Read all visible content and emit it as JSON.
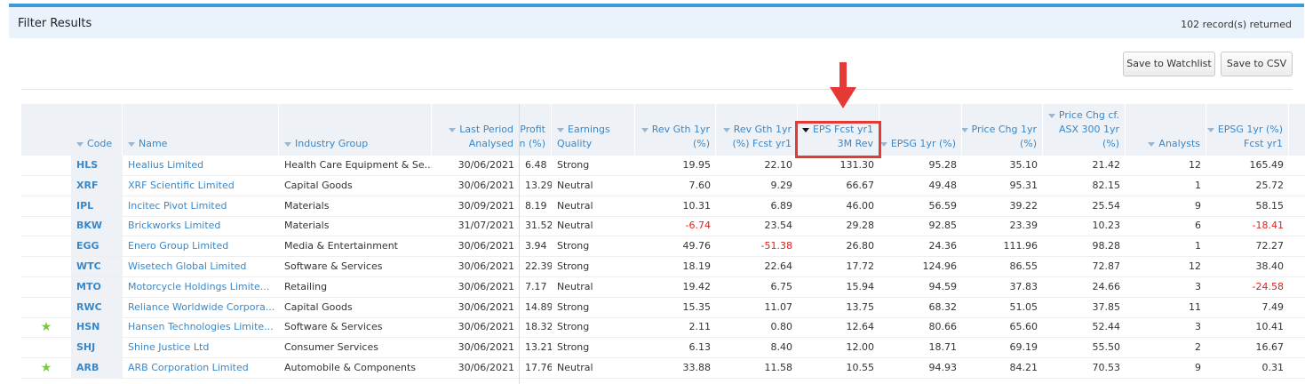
{
  "header": {
    "title": "Filter Results",
    "records": "102 record(s) returned"
  },
  "buttons": {
    "watchlist": "Save to Watchlist",
    "csv": "Save to CSV"
  },
  "columns": [
    {
      "l1": "",
      "l2": "Code"
    },
    {
      "l1": "",
      "l2": "Name"
    },
    {
      "l1": "",
      "l2": "Industry Group"
    },
    {
      "l1": "Last Period",
      "l2": "Analysed"
    },
    {
      "l1": "Profit",
      "l2": "in (%)"
    },
    {
      "l1": "Earnings",
      "l2": "Quality"
    },
    {
      "l1": "Rev Gth 1yr",
      "l2": "(%)"
    },
    {
      "l1": "Rev Gth 1yr",
      "l2": "(%) Fcst yr1"
    },
    {
      "l1": "EPS Fcst yr1",
      "l2": "3M Rev"
    },
    {
      "l1": "",
      "l2": "EPSG 1yr (%)"
    },
    {
      "l1": "Price Chg 1yr",
      "l2": "(%)"
    },
    {
      "l0": "Price Chg cf.",
      "l1": "ASX 300 1yr",
      "l2": "(%)"
    },
    {
      "l1": "",
      "l2": "Analysts"
    },
    {
      "l1": "EPSG 1yr (%)",
      "l2": "Fcst yr1"
    }
  ],
  "rows": [
    {
      "star": "",
      "code": "HLS",
      "name": "Healius Limited",
      "industry": "Health Care Equipment & Se...",
      "period": "30/06/2021",
      "margin": "6.48",
      "quality": "Strong",
      "rev1": "19.95",
      "rev1f": "22.10",
      "epsrev": "131.30",
      "epsg": "95.28",
      "price": "35.10",
      "pricecf": "21.42",
      "analysts": "12",
      "epsgf": "165.49"
    },
    {
      "star": "",
      "code": "XRF",
      "name": "XRF Scientific Limited",
      "industry": "Capital Goods",
      "period": "30/06/2021",
      "margin": "13.29",
      "quality": "Neutral",
      "rev1": "7.60",
      "rev1f": "9.29",
      "epsrev": "66.67",
      "epsg": "49.48",
      "price": "95.31",
      "pricecf": "82.15",
      "analysts": "1",
      "epsgf": "25.72"
    },
    {
      "star": "",
      "code": "IPL",
      "name": "Incitec Pivot Limited",
      "industry": "Materials",
      "period": "30/09/2021",
      "margin": "8.19",
      "quality": "Neutral",
      "rev1": "10.31",
      "rev1f": "6.89",
      "epsrev": "46.00",
      "epsg": "56.59",
      "price": "39.22",
      "pricecf": "25.54",
      "analysts": "9",
      "epsgf": "58.15"
    },
    {
      "star": "",
      "code": "BKW",
      "name": "Brickworks Limited",
      "industry": "Materials",
      "period": "31/07/2021",
      "margin": "31.52",
      "quality": "Neutral",
      "rev1": "-6.74",
      "rev1f": "23.54",
      "epsrev": "29.28",
      "epsg": "92.85",
      "price": "23.39",
      "pricecf": "10.23",
      "analysts": "6",
      "epsgf": "-18.41"
    },
    {
      "star": "",
      "code": "EGG",
      "name": "Enero Group Limited",
      "industry": "Media & Entertainment",
      "period": "30/06/2021",
      "margin": "3.94",
      "quality": "Strong",
      "rev1": "49.76",
      "rev1f": "-51.38",
      "epsrev": "26.80",
      "epsg": "24.36",
      "price": "111.96",
      "pricecf": "98.28",
      "analysts": "1",
      "epsgf": "72.27"
    },
    {
      "star": "",
      "code": "WTC",
      "name": "Wisetech Global Limited",
      "industry": "Software & Services",
      "period": "30/06/2021",
      "margin": "22.39",
      "quality": "Strong",
      "rev1": "18.19",
      "rev1f": "22.64",
      "epsrev": "17.72",
      "epsg": "124.96",
      "price": "86.55",
      "pricecf": "72.87",
      "analysts": "12",
      "epsgf": "38.40"
    },
    {
      "star": "",
      "code": "MTO",
      "name": "Motorcycle Holdings Limite...",
      "industry": "Retailing",
      "period": "30/06/2021",
      "margin": "7.17",
      "quality": "Neutral",
      "rev1": "19.42",
      "rev1f": "6.75",
      "epsrev": "15.94",
      "epsg": "94.59",
      "price": "37.83",
      "pricecf": "24.66",
      "analysts": "3",
      "epsgf": "-24.58"
    },
    {
      "star": "",
      "code": "RWC",
      "name": "Reliance Worldwide Corpora...",
      "industry": "Capital Goods",
      "period": "30/06/2021",
      "margin": "14.89",
      "quality": "Strong",
      "rev1": "15.35",
      "rev1f": "11.07",
      "epsrev": "13.75",
      "epsg": "68.32",
      "price": "51.05",
      "pricecf": "37.85",
      "analysts": "11",
      "epsgf": "7.49"
    },
    {
      "star": "★",
      "code": "HSN",
      "name": "Hansen Technologies Limite...",
      "industry": "Software & Services",
      "period": "30/06/2021",
      "margin": "18.32",
      "quality": "Strong",
      "rev1": "2.11",
      "rev1f": "0.80",
      "epsrev": "12.64",
      "epsg": "80.66",
      "price": "65.60",
      "pricecf": "52.44",
      "analysts": "3",
      "epsgf": "10.41"
    },
    {
      "star": "",
      "code": "SHJ",
      "name": "Shine Justice Ltd",
      "industry": "Consumer Services",
      "period": "30/06/2021",
      "margin": "13.21",
      "quality": "Strong",
      "rev1": "6.13",
      "rev1f": "8.40",
      "epsrev": "12.00",
      "epsg": "18.71",
      "price": "69.19",
      "pricecf": "55.50",
      "analysts": "2",
      "epsgf": "16.67"
    },
    {
      "star": "★",
      "code": "ARB",
      "name": "ARB Corporation Limited",
      "industry": "Automobile & Components",
      "period": "30/06/2021",
      "margin": "17.76",
      "quality": "Neutral",
      "rev1": "33.88",
      "rev1f": "11.58",
      "epsrev": "10.55",
      "epsg": "94.93",
      "price": "84.21",
      "pricecf": "70.53",
      "analysts": "9",
      "epsgf": "0.31"
    }
  ],
  "colors": {
    "accent": "#3b9bd8",
    "link": "#3a87c8",
    "negative": "#e02020",
    "star": "#7ac943",
    "highlight": "#e53935"
  },
  "icons": {
    "sort": "sort-down-triangle-icon",
    "favorite": "star-icon",
    "annotation": "down-arrow-icon"
  }
}
